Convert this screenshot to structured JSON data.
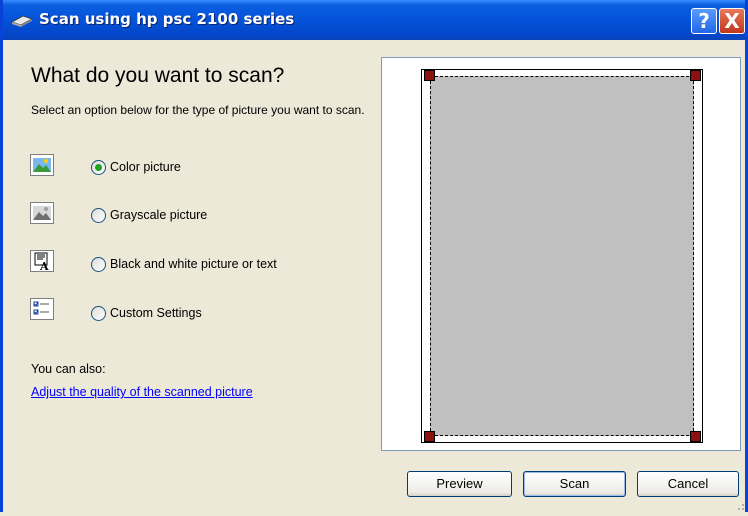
{
  "window": {
    "title": "Scan using hp psc 2100 series",
    "help_symbol": "?",
    "close_symbol": "X"
  },
  "main": {
    "heading": "What do you want to scan?",
    "description": "Select an option below for the type of picture you want to scan.",
    "options": [
      {
        "label": "Color picture",
        "icon": "color-picture-icon",
        "selected": true
      },
      {
        "label": "Grayscale picture",
        "icon": "grayscale-picture-icon",
        "selected": false
      },
      {
        "label": "Black and white picture or text",
        "icon": "bw-picture-text-icon",
        "selected": false
      },
      {
        "label": "Custom Settings",
        "icon": "custom-settings-icon",
        "selected": false
      }
    ],
    "also_label": "You can also:",
    "adjust_link": "Adjust the quality of the scanned picture"
  },
  "buttons": {
    "preview": "Preview",
    "scan": "Scan",
    "cancel": "Cancel"
  },
  "colors": {
    "titlebar": "#0552DA",
    "dialog_bg": "#ECE9D8",
    "scan_area": "#C0C0C0",
    "handle": "#8B1010",
    "link": "#0000FF",
    "radio_dot": "#21A121"
  }
}
